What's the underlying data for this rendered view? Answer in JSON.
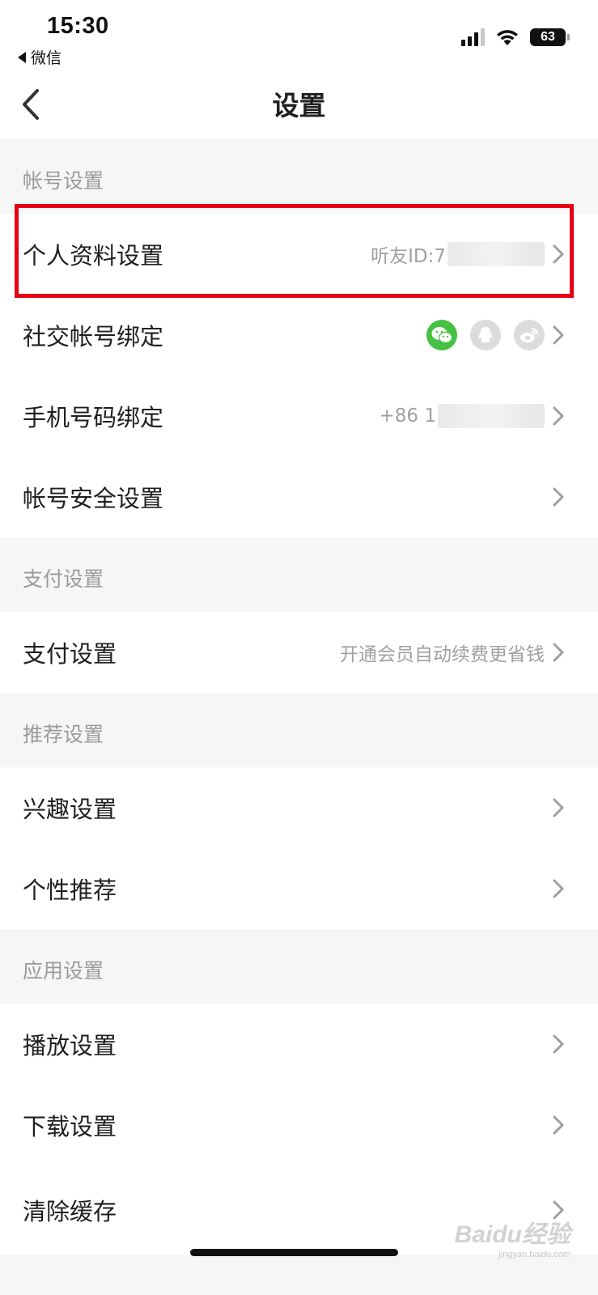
{
  "status_bar": {
    "time": "15:30",
    "back_app": "微信",
    "battery": "63"
  },
  "nav": {
    "title": "设置"
  },
  "sections": [
    {
      "header": "帐号设置",
      "items": [
        {
          "label": "个人资料设置",
          "value": "听友ID:7"
        },
        {
          "label": "社交帐号绑定",
          "icons": [
            "wechat-icon",
            "qq-icon",
            "weibo-icon"
          ]
        },
        {
          "label": "手机号码绑定",
          "value": "+86 1"
        },
        {
          "label": "帐号安全设置"
        }
      ]
    },
    {
      "header": "支付设置",
      "items": [
        {
          "label": "支付设置",
          "value": "开通会员自动续费更省钱"
        }
      ]
    },
    {
      "header": "推荐设置",
      "items": [
        {
          "label": "兴趣设置"
        },
        {
          "label": "个性推荐"
        }
      ]
    },
    {
      "header": "应用设置",
      "items": [
        {
          "label": "播放设置"
        },
        {
          "label": "下载设置"
        },
        {
          "label": "清除缓存"
        }
      ]
    }
  ],
  "colors": {
    "highlight_border": "#e60012",
    "wechat_green": "#46c144",
    "section_bg": "#f6f6f6"
  },
  "watermark": {
    "brand": "Baidu经验",
    "url": "jingyan.baidu.com"
  }
}
